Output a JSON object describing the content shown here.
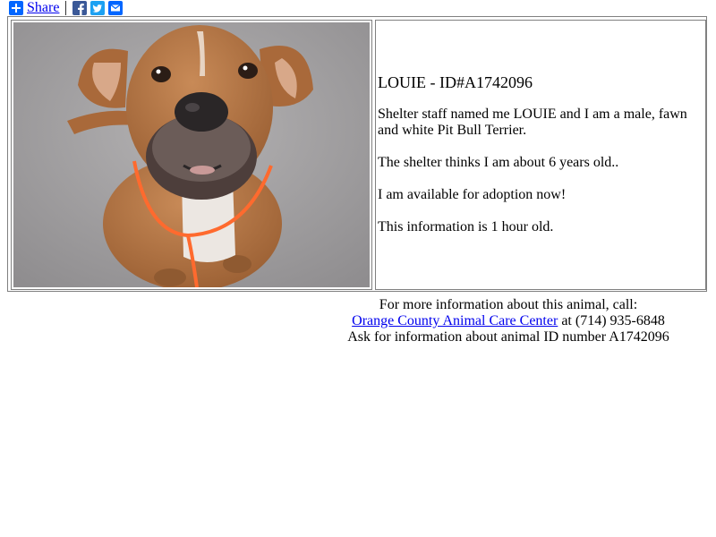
{
  "share": {
    "label": "Share",
    "icons": [
      "share-plus-icon",
      "facebook-icon",
      "twitter-icon",
      "email-icon"
    ],
    "colors": {
      "share": "#0166ff",
      "facebook": "#3b5998",
      "twitter": "#1da1f2",
      "email": "#0166ff"
    }
  },
  "animal": {
    "title": "LOUIE - ID#A1742096",
    "description": "Shelter staff named me LOUIE and I am a male, fawn and white Pit Bull Terrier.",
    "age": "The shelter thinks I am about 6 years old..",
    "availability": "I am available for adoption now!",
    "freshness": "This information is 1 hour old."
  },
  "contact": {
    "intro": "For more information about this animal, call:",
    "shelter_name": "Orange County Animal Care Center",
    "phone_text": " at (714) 935-6848",
    "ask_text": "Ask for information about animal ID number A1742096"
  },
  "colors": {
    "link": "#0000ee",
    "border": "#808080"
  }
}
